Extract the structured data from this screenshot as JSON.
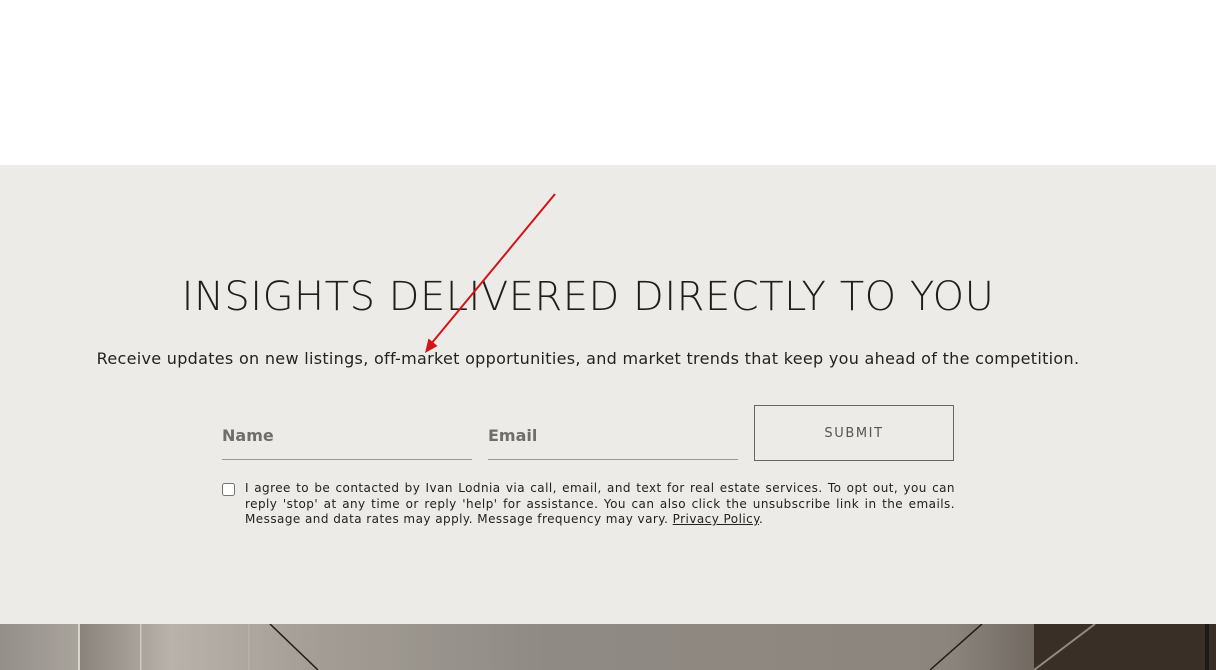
{
  "newsletter": {
    "headline": "INSIGHTS DELIVERED DIRECTLY TO YOU",
    "subline": "Receive updates on new listings, off-market opportunities, and market trends that keep you ahead of the competition.",
    "form": {
      "name_placeholder": "Name",
      "email_placeholder": "Email",
      "submit_label": "SUBMIT",
      "consent_text": "I agree to be contacted by Ivan Lodnia via call, email, and text for real estate services. To opt out, you can reply 'stop' at any time or reply 'help' for assistance. You can also click the unsubscribe link in the emails. Message and data rates may apply. Message frequency may vary.",
      "privacy_link": "Privacy Policy",
      "consent_end": "."
    }
  },
  "colors": {
    "section_bg": "#edebe7",
    "annotation_arrow": "#d0141a"
  },
  "icons": {
    "annotation": "arrow-annotation-icon"
  }
}
